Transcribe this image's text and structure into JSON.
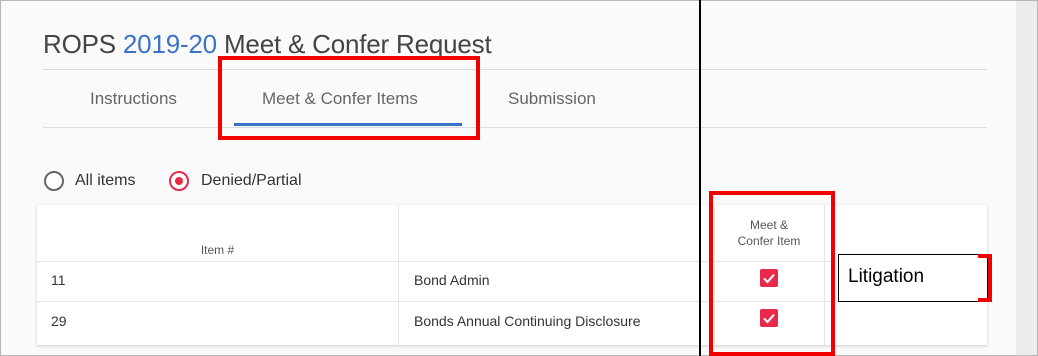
{
  "title": {
    "prefix": "ROPS ",
    "year": "2019-20",
    "suffix": " Meet & Confer Request"
  },
  "tabs": [
    {
      "label": "Instructions",
      "active": false
    },
    {
      "label": "Meet & Confer Items",
      "active": true
    },
    {
      "label": "Submission",
      "active": false
    }
  ],
  "filter": {
    "options": [
      {
        "label": "All items",
        "checked": false
      },
      {
        "label": "Denied/Partial",
        "checked": true
      }
    ]
  },
  "table": {
    "headers": {
      "item_no": "Item #",
      "description": "",
      "meet_confer_line1": "Meet &",
      "meet_confer_line2": "Confer Item"
    },
    "rows": [
      {
        "item_no": "11",
        "description": "Bond Admin",
        "meet_confer": true
      },
      {
        "item_no": "29",
        "description": "Bonds Annual Continuing Disclosure",
        "meet_confer": true
      }
    ]
  },
  "callout": {
    "label": "Litigation"
  },
  "colors": {
    "accent": "#3b73c9",
    "checkbox": "#e8294a",
    "highlight": "#f20000"
  }
}
